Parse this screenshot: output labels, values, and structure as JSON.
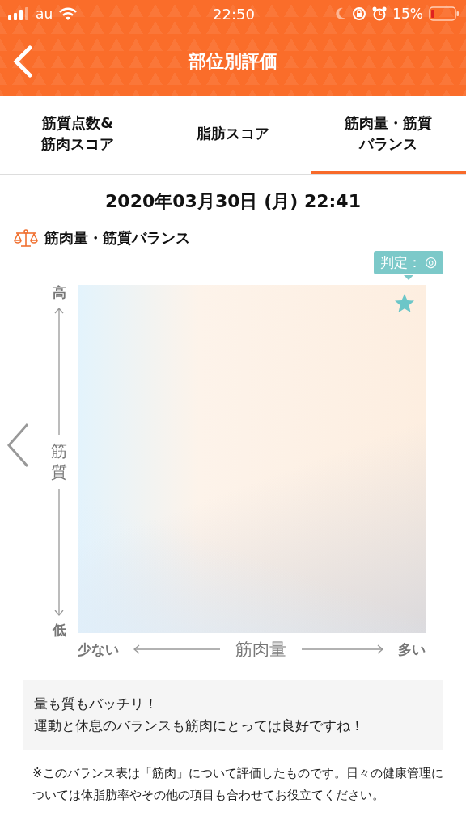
{
  "status_bar": {
    "carrier": "au",
    "time": "22:50",
    "battery": "15%"
  },
  "header": {
    "title": "部位別評価"
  },
  "tabs": [
    {
      "label_lines": [
        "筋質点数&",
        "筋肉スコア"
      ],
      "selected": false
    },
    {
      "label_lines": [
        "脂肪スコア"
      ],
      "selected": false
    },
    {
      "label_lines": [
        "筋肉量・筋質",
        "バランス"
      ],
      "selected": true
    }
  ],
  "date": "2020年03月30日 (月) 22:41",
  "section": {
    "title": "筋肉量・筋質バランス"
  },
  "chart": {
    "judgement_label": "判定：",
    "judgement_mark": "◎",
    "y_high": "高",
    "y_axis": "筋質",
    "y_low": "低",
    "x_low": "少ない",
    "x_axis": "筋肉量",
    "x_high": "多い"
  },
  "comment": [
    "量も質もバッチリ！",
    "運動と休息のバランスも筋肉にとっては良好ですね！"
  ],
  "note": "※このバランス表は「筋肉」について評価したものです。日々の健康管理については体脂肪率やその他の項目も合わせてお役立てください。"
}
